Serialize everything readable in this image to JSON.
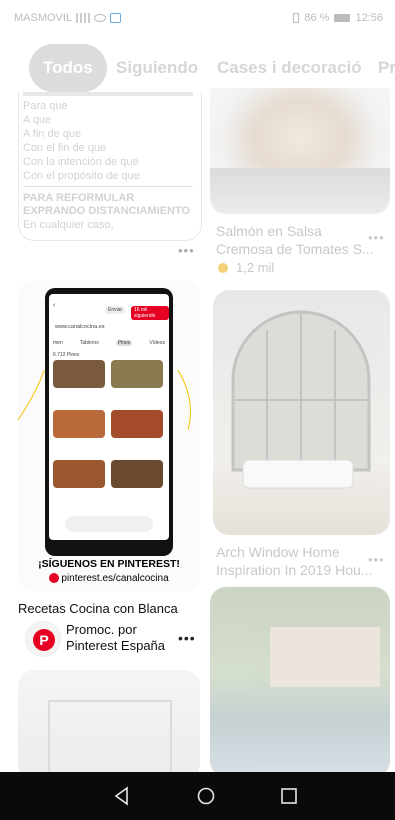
{
  "status_bar": {
    "carrier": "MASMOVIL",
    "battery": "86 %",
    "time": "12:56"
  },
  "tabs": [
    {
      "label": "Todos",
      "active": true
    },
    {
      "label": "Siguiendo",
      "active": false
    },
    {
      "label": "Cases i decoració",
      "active": false
    },
    {
      "label": "Pr",
      "active": false
    }
  ],
  "left_column": {
    "notes_pin": {
      "lines": [
        "Para que",
        "A que",
        "A fin de que",
        "Con el fin de que",
        "Con la intención de que",
        "Con el propósito de que"
      ],
      "heading_1": "PARA REFORMULAR",
      "heading_2": "EXPRANDO DISTANCIAMIENTO",
      "tail": "En cualquier caso,"
    },
    "ad_pin": {
      "phone_url": "www.canalcocina.es",
      "phone_enviar": "Enviar",
      "phone_following": "16 mil siguiendo",
      "phone_tabs": [
        "men",
        "Tableros",
        "Pines",
        "Vídeos"
      ],
      "phone_pines_count": "6.712 Pines",
      "banner_title": "¡SÍGUENOS EN PINTEREST!",
      "banner_url": "pinterest.es/canalcocina",
      "name": "Recetas Cocina con Blanca",
      "promoted_line1": "Promoc. por",
      "promoted_line2": "Pinterest España"
    }
  },
  "right_column": {
    "pin1": {
      "caption_1": "Salmón en Salsa",
      "caption_2": "Cremosa de Tomates S...",
      "saves": "1,2 mil"
    },
    "pin2": {
      "caption_1": "Arch Window Home",
      "caption_2": "Inspiration In 2019 Hou..."
    }
  },
  "more_label": "•••",
  "colors": {
    "pinterest_red": "#e60023",
    "faded_text": "#c8c8c8"
  }
}
